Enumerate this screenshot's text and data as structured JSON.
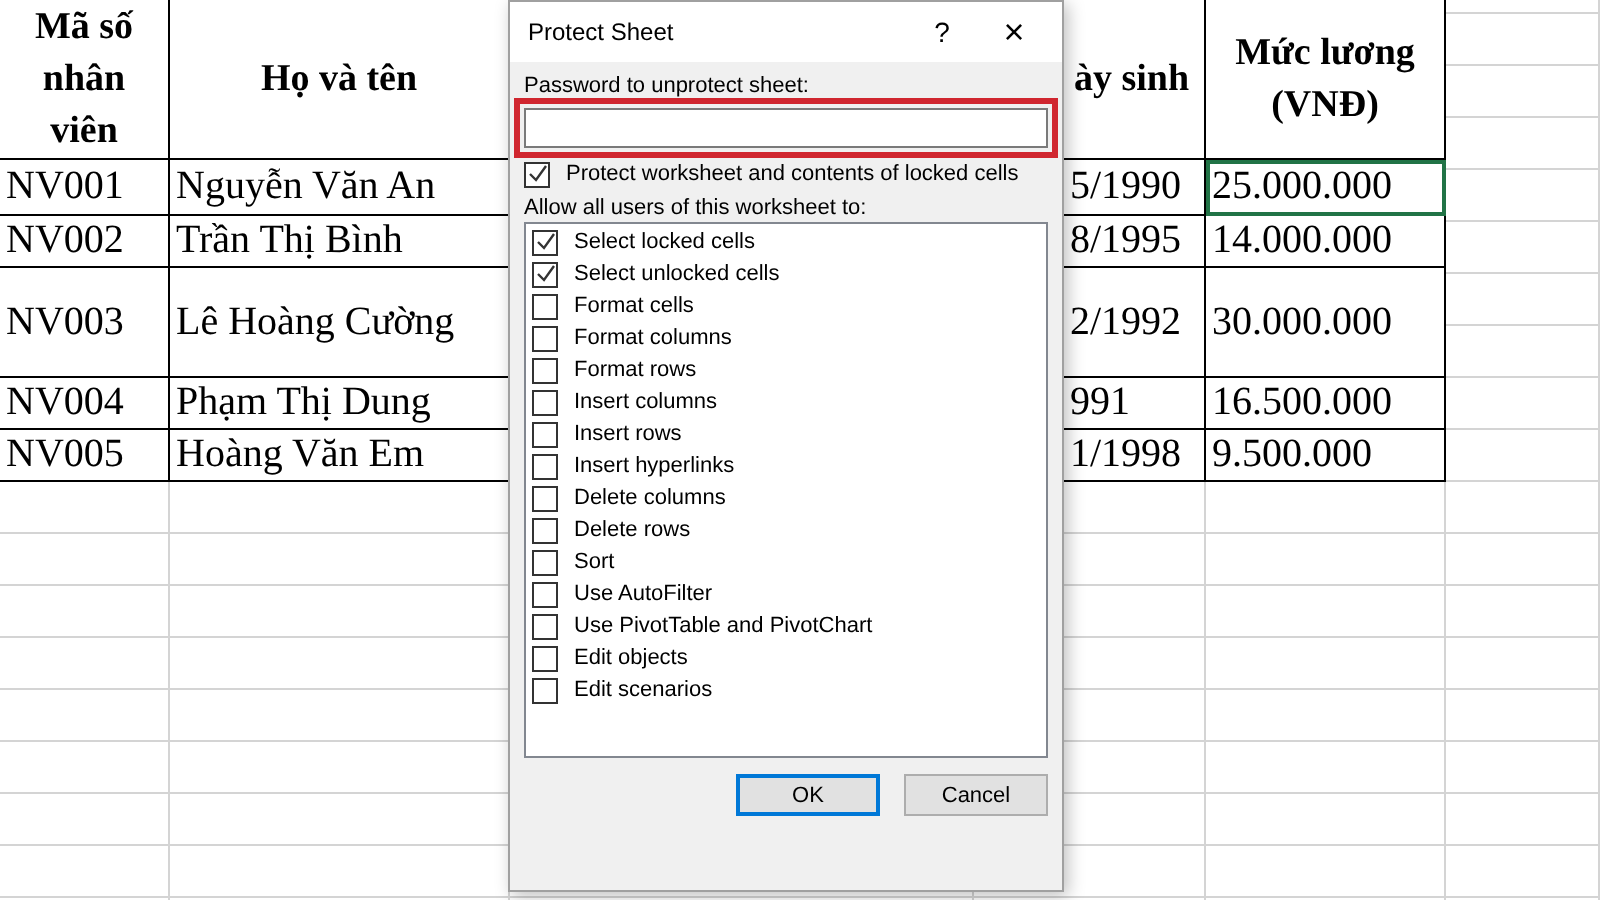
{
  "sheet": {
    "headers": [
      "Mã số nhân viên",
      "Họ và tên",
      "ày sinh",
      "Mức lương (VNĐ)"
    ],
    "rows": [
      {
        "cells": [
          {
            "text": "NV001",
            "selected": false
          },
          {
            "text": "Nguyễn Văn An",
            "selected": false
          },
          {
            "text": "5/1990",
            "selected": false
          },
          {
            "text": "25.000.000",
            "selected": true
          }
        ]
      },
      {
        "cells": [
          {
            "text": "NV002",
            "selected": false
          },
          {
            "text": "Trần Thị Bình",
            "selected": false
          },
          {
            "text": "8/1995",
            "selected": false
          },
          {
            "text": "14.000.000",
            "selected": false
          }
        ]
      },
      {
        "cells": [
          {
            "text": "NV003",
            "selected": false
          },
          {
            "text": "Lê Hoàng Cường",
            "selected": false
          },
          {
            "text": "2/1992",
            "selected": false
          },
          {
            "text": "30.000.000",
            "selected": false
          }
        ]
      },
      {
        "cells": [
          {
            "text": "NV004",
            "selected": false
          },
          {
            "text": "Phạm Thị Dung",
            "selected": false
          },
          {
            "text": "991",
            "selected": false
          },
          {
            "text": "16.500.000",
            "selected": false
          }
        ]
      },
      {
        "cells": [
          {
            "text": "NV005",
            "selected": false
          },
          {
            "text": "Hoàng Văn Em",
            "selected": false
          },
          {
            "text": "1/1998",
            "selected": false
          },
          {
            "text": "9.500.000",
            "selected": false
          }
        ]
      }
    ]
  },
  "dialog": {
    "title": "Protect Sheet",
    "help": "?",
    "close": "×",
    "password_label": "Password to unprotect sheet:",
    "password_highlighted": true,
    "protect": {
      "label": "Protect worksheet and contents of locked cells",
      "checked": true
    },
    "allow_label": "Allow all users of this worksheet to:",
    "permissions": [
      {
        "label": "Select locked cells",
        "checked": true
      },
      {
        "label": "Select unlocked cells",
        "checked": true
      },
      {
        "label": "Format cells",
        "checked": false
      },
      {
        "label": "Format columns",
        "checked": false
      },
      {
        "label": "Format rows",
        "checked": false
      },
      {
        "label": "Insert columns",
        "checked": false
      },
      {
        "label": "Insert rows",
        "checked": false
      },
      {
        "label": "Insert hyperlinks",
        "checked": false
      },
      {
        "label": "Delete columns",
        "checked": false
      },
      {
        "label": "Delete rows",
        "checked": false
      },
      {
        "label": "Sort",
        "checked": false
      },
      {
        "label": "Use AutoFilter",
        "checked": false
      },
      {
        "label": "Use PivotTable and PivotChart",
        "checked": false
      },
      {
        "label": "Edit objects",
        "checked": false
      },
      {
        "label": "Edit scenarios",
        "checked": false
      }
    ],
    "buttons": [
      {
        "label": "OK",
        "default": true
      },
      {
        "label": "Cancel",
        "default": false
      }
    ]
  }
}
